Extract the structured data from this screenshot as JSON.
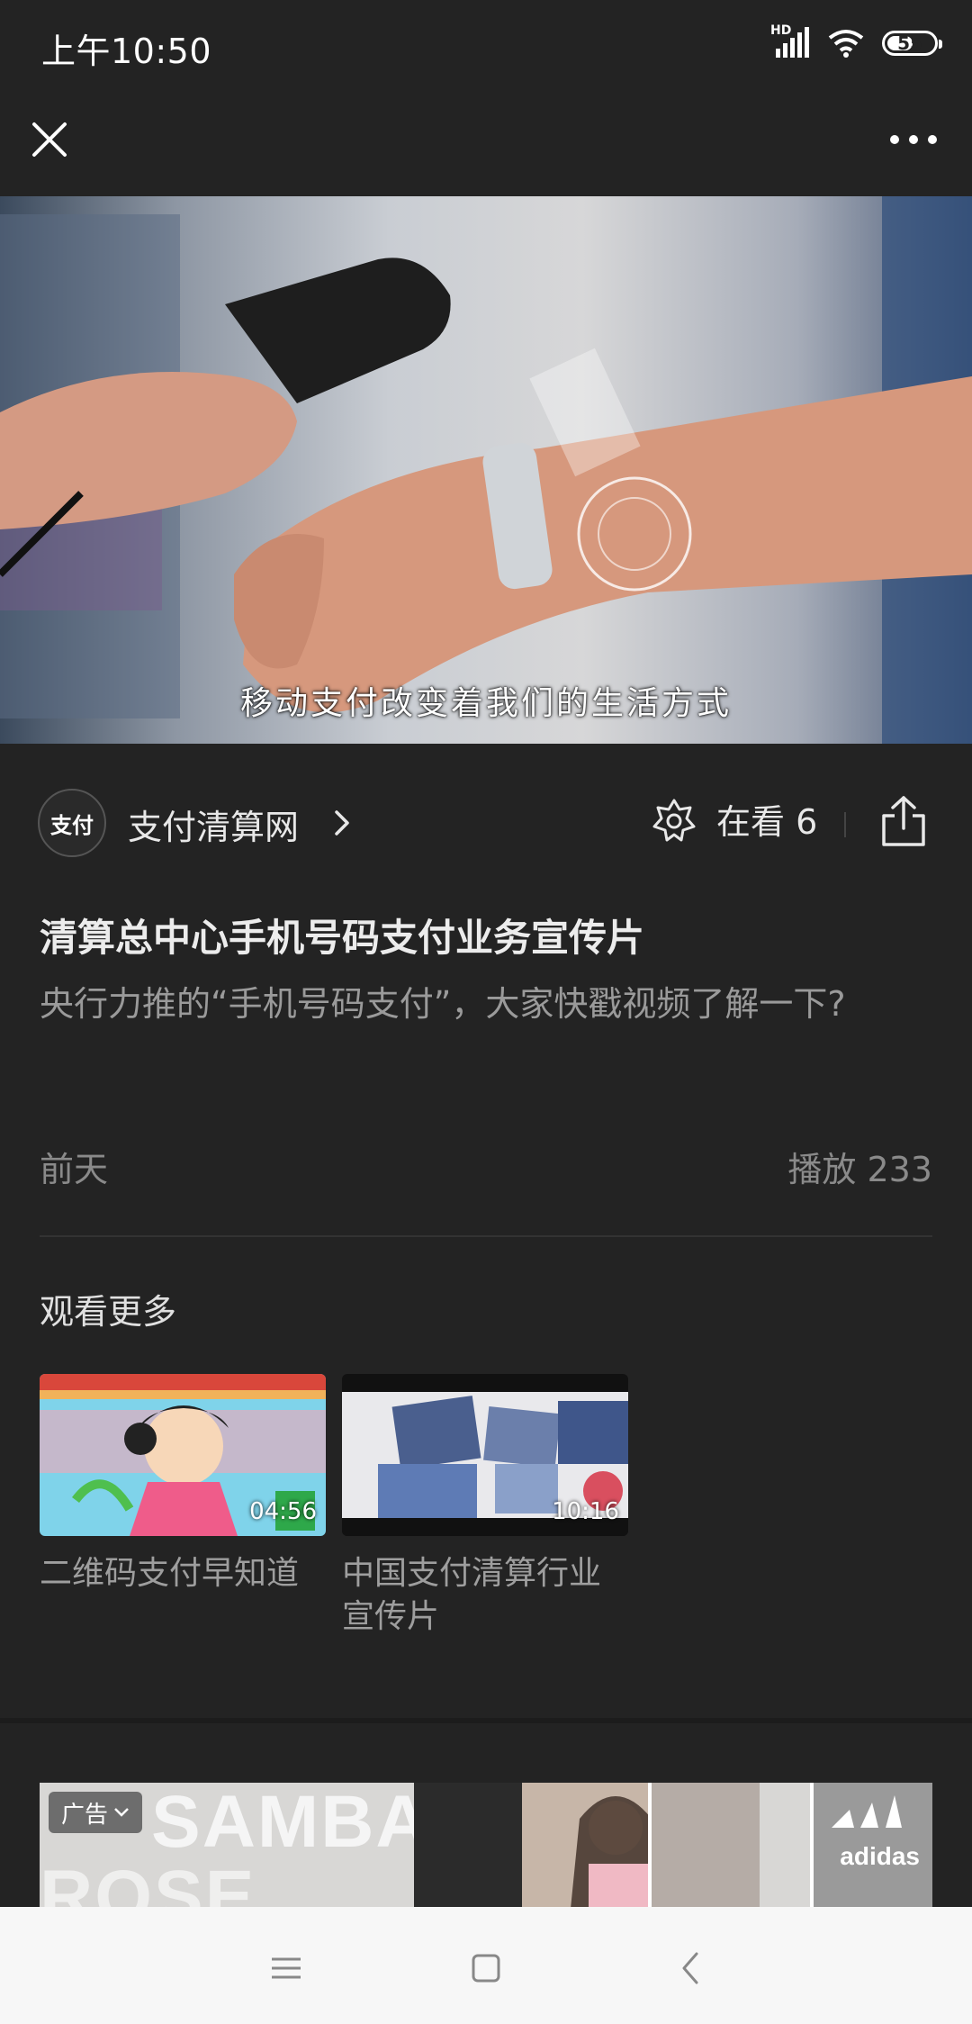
{
  "status_bar": {
    "time": "上午10:50",
    "network": "HD",
    "battery": "55",
    "battery_level": 0.55
  },
  "nav": {
    "close_icon": "close-icon",
    "more_icon": "more-icon"
  },
  "video": {
    "subtitle": "移动支付改变着我们的生活方式"
  },
  "account": {
    "avatar_text": "支付",
    "name": "支付清算网",
    "watching_label": "在看 6"
  },
  "article": {
    "title": "清算总中心手机号码支付业务宣传片",
    "description": "央行力推的“手机号码支付”，大家快戳视频了解一下?",
    "date": "前天",
    "plays": "播放 233"
  },
  "watch_more": {
    "title": "观看更多",
    "items": [
      {
        "label": "二维码支付早知道",
        "duration": "04:56"
      },
      {
        "label": "中国支付清算行业宣传片",
        "duration": "10:16"
      }
    ]
  },
  "ad": {
    "badge": "广告",
    "line1": "SAMBA",
    "line2": "ROSE",
    "brand": "adidas"
  },
  "colors": {
    "background": "#232323",
    "text_primary": "#e8e8e8",
    "text_secondary": "#9a9a9a",
    "bottom_nav": "#f7f7f7"
  }
}
